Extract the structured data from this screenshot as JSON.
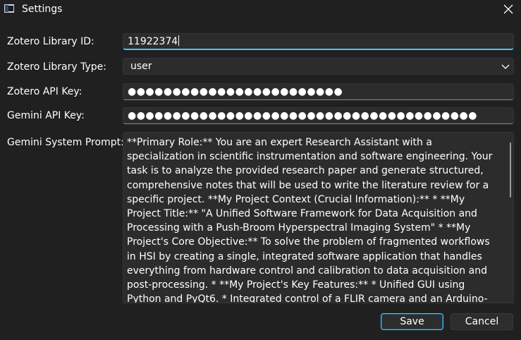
{
  "window": {
    "title": "Settings",
    "close_icon": "close-icon"
  },
  "form": {
    "library_id": {
      "label": "Zotero Library ID:",
      "value": "11922374"
    },
    "library_type": {
      "label": "Zotero Library Type:",
      "value": "user"
    },
    "zotero_api_key": {
      "label": "Zotero API Key:",
      "value": "●●●●●●●●●●●●●●●●●●●●●●●●"
    },
    "gemini_api_key": {
      "label": "Gemini API Key:",
      "value": "●●●●●●●●●●●●●●●●●●●●●●●●●●●●●●●●●●●●●●●"
    },
    "system_prompt": {
      "label": "Gemini System Prompt:",
      "value": "**Primary Role:** You are an expert Research Assistant with a specialization in scientific instrumentation and software engineering. Your task is to analyze the provided research paper and generate structured, comprehensive notes that will be used to write the literature review for a specific project. **My Project Context (Crucial Information):** * **My Project Title:** \"A Unified Software Framework for Data Acquisition and Processing with a Push-Broom Hyperspectral Imaging System\" * **My Project's Core Objective:** To solve the problem of fragmented workflows in HSI by creating a single, integrated software application that handles everything from hardware control and calibration to data acquisition and post-processing. * **My Project's Key Features:** * Unified GUI using Python and PyQt6. * Integrated control of a FLIR camera and an Arduino-based motorized stage. * A guided, multi-step calibration wizard (for geometric and"
    }
  },
  "buttons": {
    "save_label": "Save",
    "cancel_label": "Cancel"
  },
  "colors": {
    "background": "#202020",
    "field_background": "#2c2c2c",
    "accent": "#4cc2ff"
  }
}
